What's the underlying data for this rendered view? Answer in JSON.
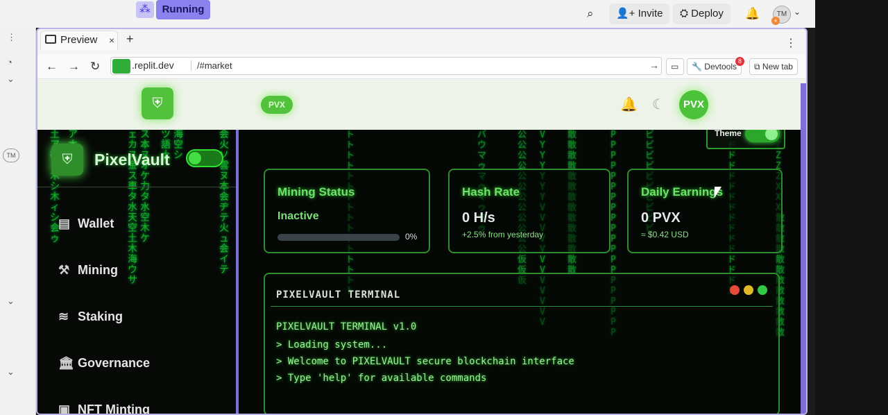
{
  "ide": {
    "run_button": "Running",
    "invite": "Invite",
    "deploy": "Deploy",
    "avatar": "TM",
    "avatar_badge": "+",
    "left_badge": "TM"
  },
  "preview": {
    "tab_label": "Preview",
    "url_host": ".replit.dev",
    "url_path": "/#market",
    "devtools": "Devtools",
    "devtools_count": "8",
    "new_tab": "New tab"
  },
  "header": {
    "pvx_pill": "PVX",
    "pvx_circle": "PVX"
  },
  "sidebar": {
    "brand": "PixelVault",
    "items": [
      {
        "label": "Wallet",
        "icon": "wallet-icon"
      },
      {
        "label": "Mining",
        "icon": "hammer-icon"
      },
      {
        "label": "Staking",
        "icon": "layers-icon"
      },
      {
        "label": "Governance",
        "icon": "bank-icon"
      },
      {
        "label": "NFT Minting",
        "icon": "image-icon"
      }
    ]
  },
  "theme": {
    "label": "Theme",
    "on": true
  },
  "cards": {
    "mining": {
      "title": "Mining Status",
      "status": "Inactive",
      "progress": 0,
      "progress_label": "0%"
    },
    "hash": {
      "title": "Hash Rate",
      "value": "0 H/s",
      "sub": "+2.5% from yesterday"
    },
    "earnings": {
      "title": "Daily Earnings",
      "value": "0 PVX",
      "sub": "≈ $0.42 USD"
    }
  },
  "terminal": {
    "title": "PIXELVAULT TERMINAL",
    "lines": [
      "PIXELVAULT TERMINAL v1.0",
      "> Loading system...",
      "> Welcome to PIXELVAULT secure blockchain interface",
      "> Type 'help' for available commands"
    ]
  },
  "colors": {
    "accent": "#2fcf2f",
    "frame": "#7d6ed8"
  }
}
